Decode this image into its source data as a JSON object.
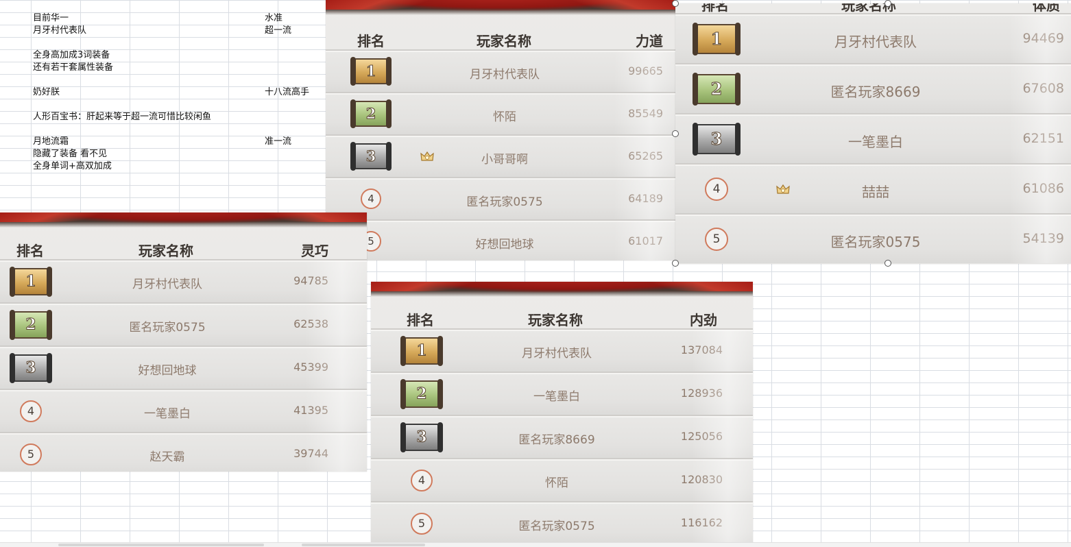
{
  "spreadsheet": {
    "cells": [
      {
        "text": "目前华一",
        "col": "a",
        "row": 1
      },
      {
        "text": "水准",
        "col": "b",
        "row": 1
      },
      {
        "text": "月牙村代表队",
        "col": "a",
        "row": 2
      },
      {
        "text": "超一流",
        "col": "b",
        "row": 2
      },
      {
        "text": "全身高加成3词装备",
        "col": "a",
        "row": 4
      },
      {
        "text": "还有若干套属性装备",
        "col": "a",
        "row": 5
      },
      {
        "text": "奶好朕",
        "col": "a",
        "row": 7
      },
      {
        "text": "十八流高手",
        "col": "b",
        "row": 7
      },
      {
        "text": "人形百宝书：肝起来等于超一流可惜比较闲鱼",
        "col": "a",
        "row": 9
      },
      {
        "text": "月地流霜",
        "col": "a",
        "row": 11
      },
      {
        "text": "准一流",
        "col": "b",
        "row": 11
      },
      {
        "text": "隐藏了装备      看不见",
        "col": "a",
        "row": 12
      },
      {
        "text": "全身单词+高双加成",
        "col": "a",
        "row": 13
      }
    ]
  },
  "boards": {
    "strength": {
      "headers": {
        "rank": "排名",
        "name": "玩家名称",
        "stat": "力道"
      },
      "rows": [
        {
          "rank": "1",
          "name": "月牙村代表队",
          "value": "99665",
          "crown": false
        },
        {
          "rank": "2",
          "name": "怀陌",
          "value": "85549",
          "crown": false
        },
        {
          "rank": "3",
          "name": "小哥哥啊",
          "value": "65265",
          "crown": true
        },
        {
          "rank": "4",
          "name": "匿名玩家0575",
          "value": "64189",
          "crown": false
        },
        {
          "rank": "5",
          "name": "好想回地球",
          "value": "61017",
          "crown": false
        }
      ]
    },
    "body": {
      "headers": {
        "rank": "排名",
        "name": "玩家名称",
        "stat": "体质"
      },
      "rows": [
        {
          "rank": "1",
          "name": "月牙村代表队",
          "value": "94469",
          "crown": false
        },
        {
          "rank": "2",
          "name": "匿名玩家8669",
          "value": "67608",
          "crown": false
        },
        {
          "rank": "3",
          "name": "一笔墨白",
          "value": "62151",
          "crown": false
        },
        {
          "rank": "4",
          "name": "喆喆",
          "value": "61086",
          "crown": true
        },
        {
          "rank": "5",
          "name": "匿名玩家0575",
          "value": "54139",
          "crown": false
        }
      ]
    },
    "agility": {
      "headers": {
        "rank": "排名",
        "name": "玩家名称",
        "stat": "灵巧"
      },
      "rows": [
        {
          "rank": "1",
          "name": "月牙村代表队",
          "value": "94785",
          "crown": false
        },
        {
          "rank": "2",
          "name": "匿名玩家0575",
          "value": "62538",
          "crown": false
        },
        {
          "rank": "3",
          "name": "好想回地球",
          "value": "45399",
          "crown": false
        },
        {
          "rank": "4",
          "name": "一笔墨白",
          "value": "41395",
          "crown": false
        },
        {
          "rank": "5",
          "name": "赵天霸",
          "value": "39744",
          "crown": false
        }
      ]
    },
    "inner": {
      "headers": {
        "rank": "排名",
        "name": "玩家名称",
        "stat": "内劲"
      },
      "rows": [
        {
          "rank": "1",
          "name": "月牙村代表队",
          "value": "137084",
          "crown": false
        },
        {
          "rank": "2",
          "name": "一笔墨白",
          "value": "128936",
          "crown": false
        },
        {
          "rank": "3",
          "name": "匿名玩家8669",
          "value": "125056",
          "crown": false
        },
        {
          "rank": "4",
          "name": "怀陌",
          "value": "120830",
          "crown": false
        },
        {
          "rank": "5",
          "name": "匿名玩家0575",
          "value": "116162",
          "crown": false
        }
      ]
    }
  },
  "colors": {
    "row_text": "#8d7a6c",
    "header_text": "#3c3631",
    "gold_scroll": "#d6a95a",
    "jade_scroll": "#a9c47d",
    "silver_scroll": "#a9a9a9",
    "ring_border": "#d07a5c",
    "banner_red": "#a51d16"
  },
  "icons": [
    "scroll-rank-icon",
    "rank-ring-icon",
    "crown-icon",
    "selection-handle"
  ]
}
